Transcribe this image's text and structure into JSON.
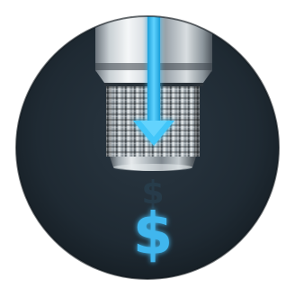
{
  "illustration": {
    "subject": "threaded-pipe-with-flow-arrow-to-dollar",
    "colors": {
      "background_disc": "#1f2a33",
      "disc_edge": "#141c22",
      "metal_light": "#eef2f4",
      "metal_mid": "#a9b2b8",
      "metal_dark": "#5f6870",
      "flow_blue": "#2ab4ee",
      "flow_blue_glow": "#63d3ff",
      "dollar_blue": "#3fb6ee",
      "dollar_faint": "#2b4a5e"
    },
    "icons": {
      "pipe": "pipe-fitting-icon",
      "arrow": "down-arrow-icon",
      "currency": "dollar-icon"
    },
    "glyphs": {
      "currency_symbol": "$"
    }
  }
}
